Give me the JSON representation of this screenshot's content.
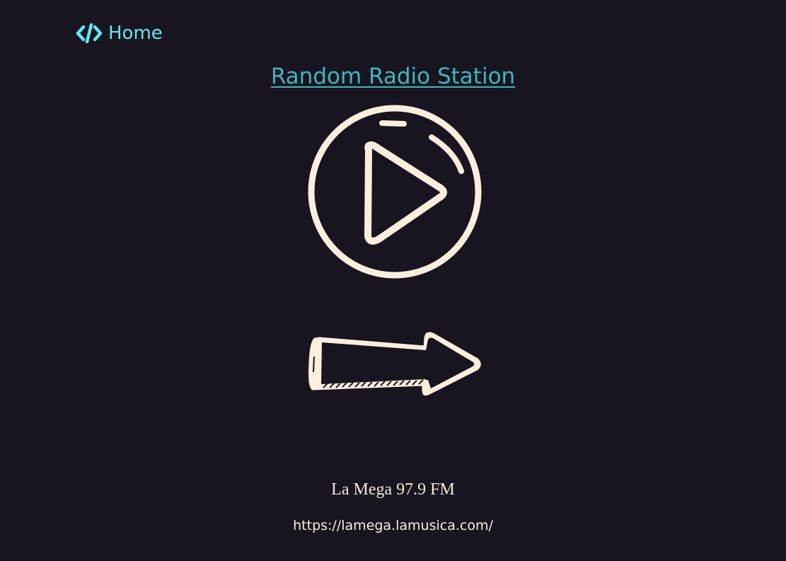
{
  "nav": {
    "home_label": "Home",
    "home_icon": "code-icon"
  },
  "page": {
    "title": "Random Radio Station"
  },
  "controls": {
    "play_icon": "play-circle-icon",
    "next_icon": "arrow-right-icon"
  },
  "station": {
    "name": "La Mega 97.9 FM",
    "url": "https://lamega.lamusica.com/"
  },
  "colors": {
    "background": "#181520",
    "accent": "#63e6f2",
    "title_link": "#3fb6bd",
    "cream": "#fbeedd"
  }
}
